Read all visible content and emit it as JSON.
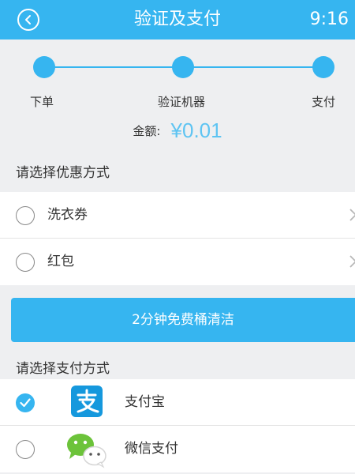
{
  "header": {
    "title": "验证及支付",
    "time": "9:16"
  },
  "steps": [
    {
      "label": "下单"
    },
    {
      "label": "验证机器"
    },
    {
      "label": "支付"
    }
  ],
  "amount": {
    "label": "金额:",
    "value": "¥0.01"
  },
  "discount": {
    "title": "请选择优惠方式",
    "options": [
      {
        "label": "洗衣券",
        "selected": false
      },
      {
        "label": "红包",
        "selected": false
      }
    ]
  },
  "clean_button": {
    "label": "2分钟免费桶清洁"
  },
  "payment": {
    "title": "请选择支付方式",
    "methods": [
      {
        "label": "支付宝",
        "icon": "alipay-icon",
        "selected": true
      },
      {
        "label": "微信支付",
        "icon": "wechat-icon",
        "selected": false
      }
    ]
  },
  "colors": {
    "accent": "#36b5f0",
    "amount": "#5ec4f2",
    "background": "#eeeff1"
  }
}
